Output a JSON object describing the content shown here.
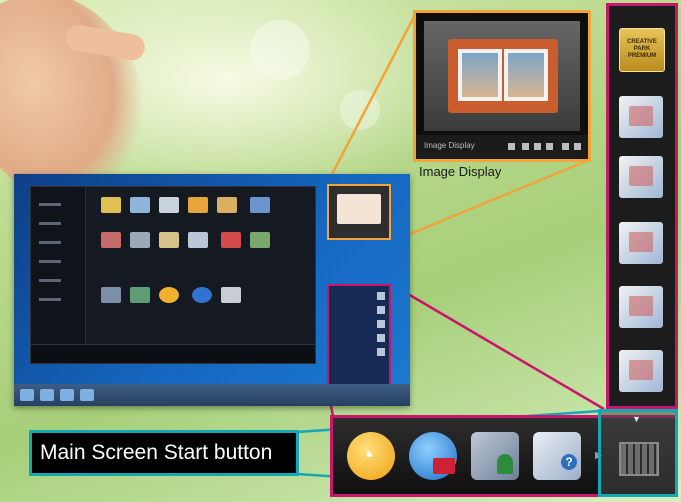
{
  "image_display": {
    "label": "Image Display",
    "bar_text": "Image Display"
  },
  "sidebar": {
    "top_tile_text": "CREATIVE PARK PREMIUM"
  },
  "callout": {
    "label": "Main Screen Start button"
  },
  "colors": {
    "image_display_accent": "#f0a43a",
    "launcher_accent": "#c9156c",
    "start_button_accent": "#16a7b5"
  },
  "launcher_icons": [
    "wifi-icon",
    "web-globe-cart-icon",
    "photo-share-icon",
    "help-icon"
  ]
}
